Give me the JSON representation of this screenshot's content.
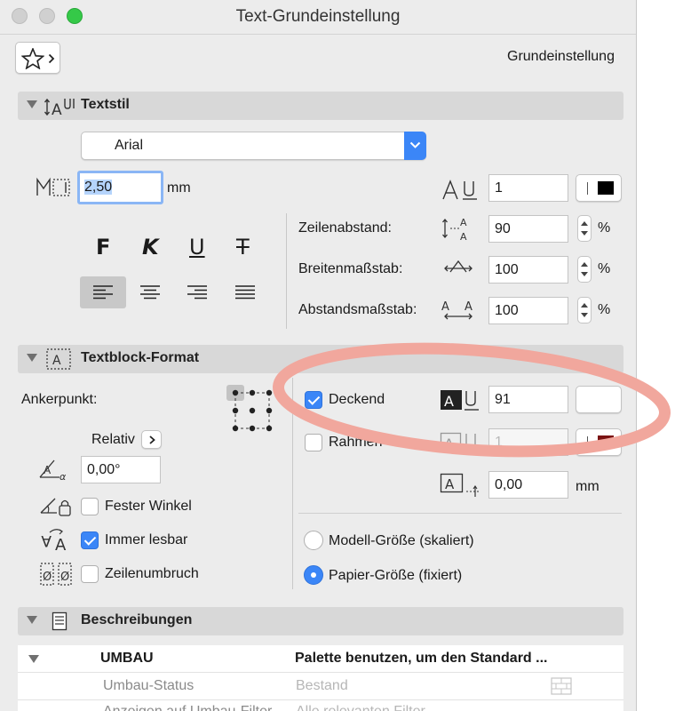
{
  "window": {
    "title": "Text-Grundeinstellung"
  },
  "header": {
    "preset_label": "Grundeinstellung"
  },
  "textstil": {
    "section_title": "Textstil",
    "font": "Arial",
    "size": "2,50",
    "size_unit": "mm",
    "pen": "1",
    "style_buttons": {
      "bold": "F",
      "italic": "K",
      "underline": "U",
      "strike": "T"
    },
    "line_spacing": {
      "label": "Zeilenabstand:",
      "value": "90",
      "unit": "%"
    },
    "width_scale": {
      "label": "Breitenmaßstab:",
      "value": "100",
      "unit": "%"
    },
    "spacing_scale": {
      "label": "Abstandsmaßstab:",
      "value": "100",
      "unit": "%"
    }
  },
  "textblock": {
    "section_title": "Textblock-Format",
    "anchor_label": "Ankerpunkt:",
    "relative_label": "Relativ",
    "angle_value": "0,00°",
    "fixed_angle_label": "Fester Winkel",
    "always_readable_label": "Immer lesbar",
    "wrap_label": "Zeilenumbruch",
    "opaque_label": "Deckend",
    "opaque_pen": "91",
    "frame_label": "Rahmen",
    "frame_pen": "1",
    "frame_offset": "0,00",
    "frame_offset_unit": "mm",
    "model_size_label": "Modell-Größe (skaliert)",
    "paper_size_label": "Papier-Größe (fixiert)"
  },
  "beschreibungen": {
    "section_title": "Beschreibungen",
    "table": {
      "group_name": "UMBAU",
      "group_value": "Palette benutzen, um den Standard ...",
      "rows": [
        {
          "name": "Umbau-Status",
          "value": "Bestand"
        },
        {
          "name": "Anzeigen auf Umbau-Filter",
          "value": "Alle relevanten Filter"
        }
      ]
    }
  },
  "colors": {
    "accent": "#3b86f7",
    "annotation": "#f1a79d",
    "frame_pen": "#7a1212"
  },
  "checks": {
    "opaque": true,
    "frame": false,
    "fixed_angle": false,
    "always_readable": true,
    "wrap": false
  },
  "radio_selected": "paper"
}
